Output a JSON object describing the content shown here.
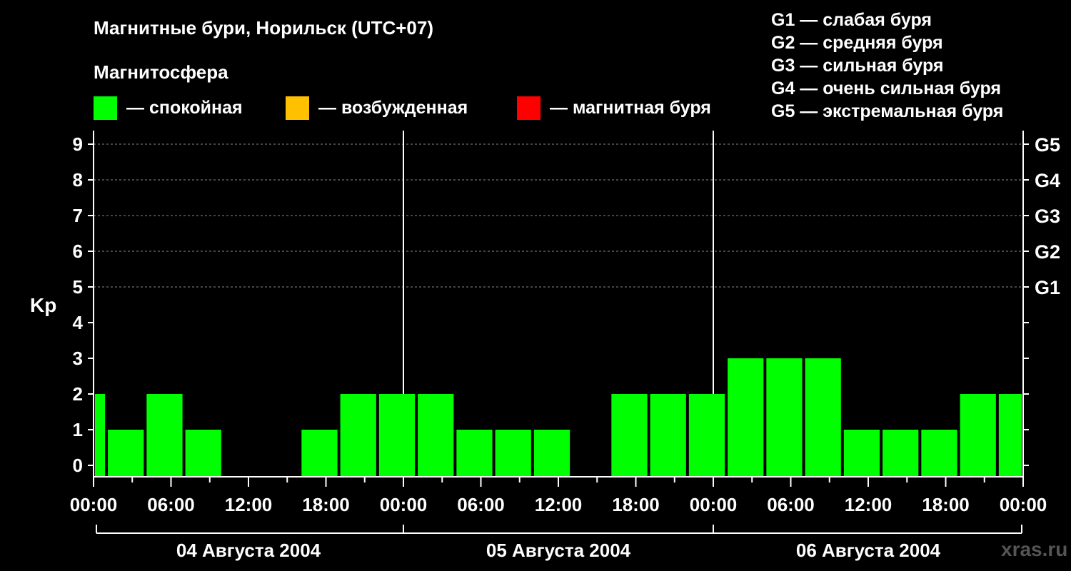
{
  "title": "Магнитные бури, Норильск (UTC+07)",
  "legend": {
    "heading": "Магнитосфера",
    "items": [
      {
        "label": "— спокойная",
        "color": "#00ff00"
      },
      {
        "label": "— возбужденная",
        "color": "#ffc000"
      },
      {
        "label": "— магнитная буря",
        "color": "#ff0000"
      }
    ]
  },
  "g_scale": [
    "G1 — слабая буря",
    "G2 — средняя буря",
    "G3 — сильная буря",
    "G4 — очень сильная буря",
    "G5 — экстремальная буря"
  ],
  "watermark": "xras.ru",
  "chart_data": {
    "type": "bar",
    "ylabel": "Kp",
    "ylim": [
      0,
      9
    ],
    "yticks": [
      "0",
      "1",
      "2",
      "3",
      "4",
      "5",
      "6",
      "7",
      "8",
      "9"
    ],
    "right_ticks": [
      {
        "y": 5,
        "label": "G1"
      },
      {
        "y": 6,
        "label": "G2"
      },
      {
        "y": 7,
        "label": "G3"
      },
      {
        "y": 8,
        "label": "G4"
      },
      {
        "y": 9,
        "label": "G5"
      }
    ],
    "xlim_hours": [
      0,
      72
    ],
    "xticks": [
      {
        "hour": 0,
        "label": "00:00"
      },
      {
        "hour": 6,
        "label": "06:00"
      },
      {
        "hour": 12,
        "label": "12:00"
      },
      {
        "hour": 18,
        "label": "18:00"
      },
      {
        "hour": 24,
        "label": "00:00"
      },
      {
        "hour": 30,
        "label": "06:00"
      },
      {
        "hour": 36,
        "label": "12:00"
      },
      {
        "hour": 42,
        "label": "18:00"
      },
      {
        "hour": 48,
        "label": "00:00"
      },
      {
        "hour": 54,
        "label": "06:00"
      },
      {
        "hour": 60,
        "label": "12:00"
      },
      {
        "hour": 66,
        "label": "18:00"
      },
      {
        "hour": 72,
        "label": "00:00"
      }
    ],
    "days": [
      "04 Августа 2004",
      "05 Августа 2004",
      "06 Августа 2004"
    ],
    "bars": [
      {
        "start": 0,
        "end": 1,
        "kp": 2
      },
      {
        "start": 1,
        "end": 4,
        "kp": 1
      },
      {
        "start": 4,
        "end": 7,
        "kp": 2
      },
      {
        "start": 7,
        "end": 10,
        "kp": 1
      },
      {
        "start": 10,
        "end": 13,
        "kp": 0
      },
      {
        "start": 13,
        "end": 16,
        "kp": 0
      },
      {
        "start": 16,
        "end": 19,
        "kp": 1
      },
      {
        "start": 19,
        "end": 22,
        "kp": 2
      },
      {
        "start": 22,
        "end": 25,
        "kp": 2
      },
      {
        "start": 25,
        "end": 28,
        "kp": 2
      },
      {
        "start": 28,
        "end": 31,
        "kp": 1
      },
      {
        "start": 31,
        "end": 34,
        "kp": 1
      },
      {
        "start": 34,
        "end": 37,
        "kp": 1
      },
      {
        "start": 37,
        "end": 40,
        "kp": 0
      },
      {
        "start": 40,
        "end": 43,
        "kp": 2
      },
      {
        "start": 43,
        "end": 46,
        "kp": 2
      },
      {
        "start": 46,
        "end": 49,
        "kp": 2
      },
      {
        "start": 49,
        "end": 52,
        "kp": 3
      },
      {
        "start": 52,
        "end": 55,
        "kp": 3
      },
      {
        "start": 55,
        "end": 58,
        "kp": 3
      },
      {
        "start": 58,
        "end": 61,
        "kp": 1
      },
      {
        "start": 61,
        "end": 64,
        "kp": 1
      },
      {
        "start": 64,
        "end": 67,
        "kp": 1
      },
      {
        "start": 67,
        "end": 70,
        "kp": 2
      },
      {
        "start": 70,
        "end": 72,
        "kp": 2
      }
    ],
    "grid": "dashed horizontal at 5-9",
    "legend_position": "top"
  }
}
